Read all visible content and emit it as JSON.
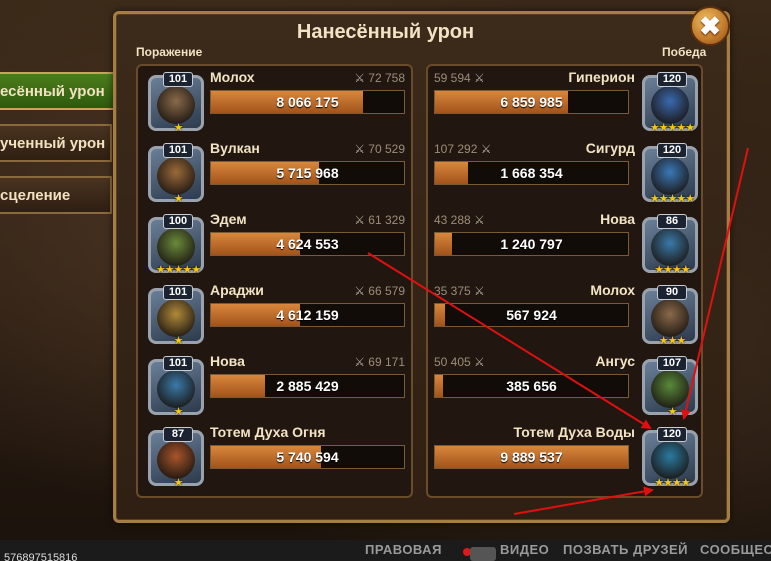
{
  "window": {
    "title": "Нанесённый урон",
    "close_label": "✖"
  },
  "tabs": [
    {
      "label": "есённый урон",
      "active": true
    },
    {
      "label": "ученный урон",
      "active": false
    },
    {
      "label": "сцеление",
      "active": false
    }
  ],
  "labels": {
    "left_side": "Поражение",
    "right_side": "Победа"
  },
  "left_team": [
    {
      "name": "Молох",
      "level": "101",
      "stat": "72 758",
      "damage": "8 066 175",
      "fill_fraction": 0.79,
      "stars": "★",
      "color": "#8a6a4a"
    },
    {
      "name": "Вулкан",
      "level": "101",
      "stat": "70 529",
      "damage": "5 715 968",
      "fill_fraction": 0.56,
      "stars": "★",
      "color": "#9a6a3a"
    },
    {
      "name": "Эдем",
      "level": "100",
      "stat": "61 329",
      "damage": "4 624 553",
      "fill_fraction": 0.46,
      "stars": "★★★★★",
      "color": "#6a8a3a"
    },
    {
      "name": "Араджи",
      "level": "101",
      "stat": "66 579",
      "damage": "4 612 159",
      "fill_fraction": 0.46,
      "stars": "★",
      "color": "#b08a3a"
    },
    {
      "name": "Нова",
      "level": "101",
      "stat": "69 171",
      "damage": "2 885 429",
      "fill_fraction": 0.28,
      "stars": "★",
      "color": "#3a7aa8"
    },
    {
      "name": "Тотем Духа Огня",
      "level": "87",
      "stat": "",
      "damage": "5 740 594",
      "fill_fraction": 0.57,
      "stars": "★",
      "color": "#a8552a"
    }
  ],
  "right_team": [
    {
      "name": "Гиперион",
      "level": "120",
      "stat": "59 594",
      "damage": "6 859 985",
      "fill_fraction": 0.69,
      "stars": "★★★★★",
      "color": "#3a6ab0"
    },
    {
      "name": "Сигурд",
      "level": "120",
      "stat": "107 292",
      "damage": "1 668 354",
      "fill_fraction": 0.17,
      "stars": "★★★★★",
      "color": "#3a78b8"
    },
    {
      "name": "Нова",
      "level": "86",
      "stat": "43 288",
      "damage": "1 240 797",
      "fill_fraction": 0.09,
      "stars": "★★★★",
      "color": "#3a7aa8"
    },
    {
      "name": "Молох",
      "level": "90",
      "stat": "35 375",
      "damage": "567 924",
      "fill_fraction": 0.05,
      "stars": "★★★",
      "color": "#8a6a4a"
    },
    {
      "name": "Ангус",
      "level": "107",
      "stat": "50 405",
      "damage": "385 656",
      "fill_fraction": 0.04,
      "stars": "★",
      "color": "#5a8a3a"
    },
    {
      "name": "Тотем Духа Воды",
      "level": "120",
      "stat": "",
      "damage": "9 889 537",
      "fill_fraction": 1.0,
      "stars": "★★★★",
      "color": "#2a7aa0"
    }
  ],
  "bottom_bar": {
    "user_id": "576897515816",
    "links": [
      "ПРАВОВАЯ",
      "ВИДЕО",
      "ПОЗВАТЬ ДРУЗЕЙ",
      "СООБЩЕСТВ"
    ]
  },
  "colors": {
    "accent": "#c9a45a",
    "bar_fill": "#c8702c",
    "annotation_arrow": "#e01010"
  }
}
